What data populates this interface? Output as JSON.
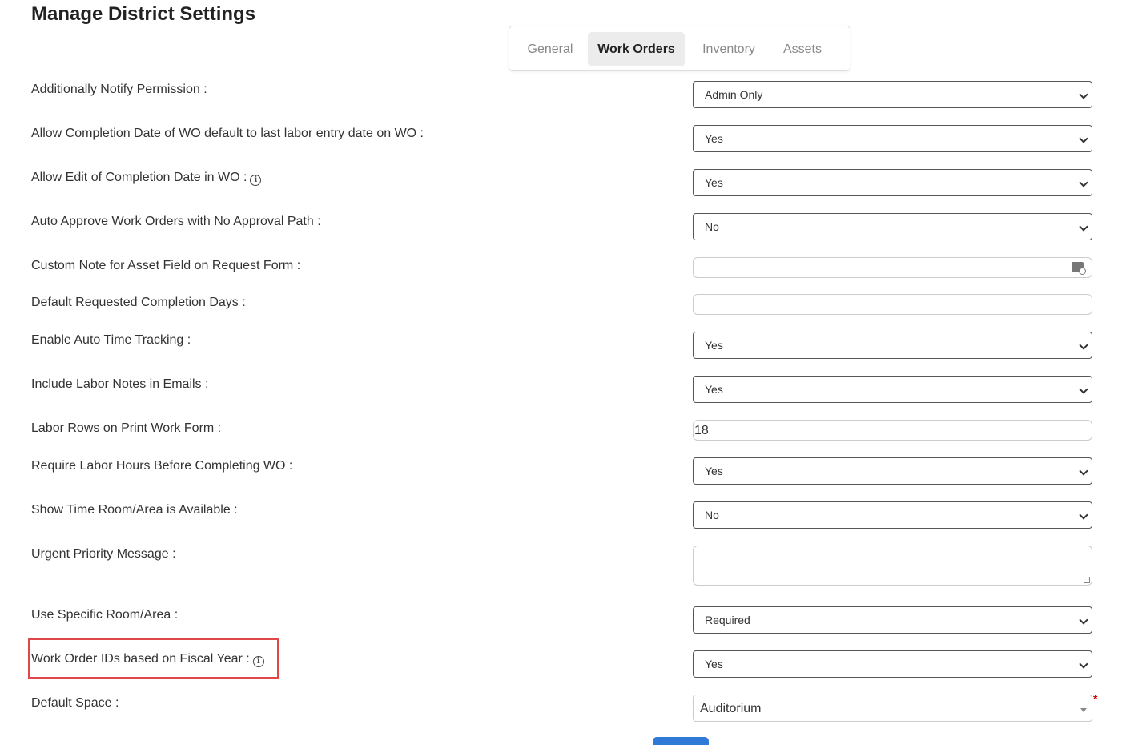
{
  "page": {
    "title": "Manage District Settings"
  },
  "tabs": [
    {
      "label": "General",
      "active": false
    },
    {
      "label": "Work Orders",
      "active": true
    },
    {
      "label": "Inventory",
      "active": false
    },
    {
      "label": "Assets",
      "active": false
    }
  ],
  "settings": {
    "additionally_notify": {
      "label": "Additionally Notify Permission :",
      "value": "Admin Only"
    },
    "completion_date_default": {
      "label": "Allow Completion Date of WO default to last labor entry date on WO :",
      "value": "Yes"
    },
    "edit_completion_date": {
      "label": "Allow Edit of Completion Date in WO :",
      "value": "Yes"
    },
    "auto_approve": {
      "label": "Auto Approve Work Orders with No Approval Path :",
      "value": "No"
    },
    "custom_note_asset": {
      "label": "Custom Note for Asset Field on Request Form :",
      "value": ""
    },
    "default_completion_days": {
      "label": "Default Requested Completion Days :",
      "value": ""
    },
    "auto_time_tracking": {
      "label": "Enable Auto Time Tracking :",
      "value": "Yes"
    },
    "labor_notes_emails": {
      "label": "Include Labor Notes in Emails :",
      "value": "Yes"
    },
    "labor_rows_print": {
      "label": "Labor Rows on Print Work Form :",
      "value": "18"
    },
    "require_labor_hours": {
      "label": "Require Labor Hours Before Completing WO :",
      "value": "Yes"
    },
    "show_time_room": {
      "label": "Show Time Room/Area is Available :",
      "value": "No"
    },
    "urgent_priority_message": {
      "label": "Urgent Priority Message :",
      "value": ""
    },
    "specific_room_area": {
      "label": "Use Specific Room/Area :",
      "value": "Required"
    },
    "fiscal_year_ids": {
      "label": "Work Order IDs based on Fiscal Year :",
      "value": "Yes"
    },
    "default_space": {
      "label": "Default Space :",
      "value": "Auditorium",
      "required_marker": "*"
    }
  },
  "icons": {
    "info": "info-circle-icon",
    "keyboard": "keyboard-icon"
  },
  "colors": {
    "highlight": "#e04848",
    "required": "#cc0000",
    "primary_button": "#2f7ad6"
  }
}
